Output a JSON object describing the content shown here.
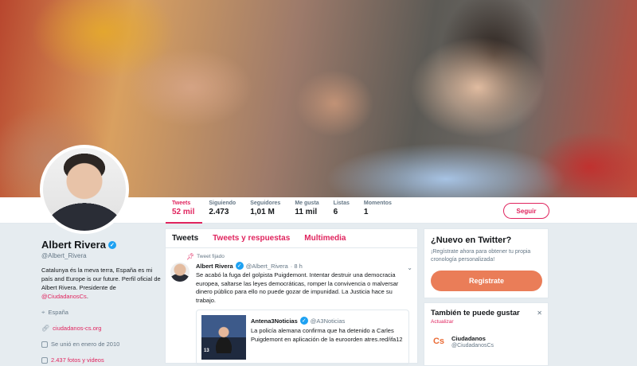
{
  "banner": {
    "alt": "header photo"
  },
  "stats": [
    {
      "label": "Tweets",
      "value": "52 mil"
    },
    {
      "label": "Siguiendo",
      "value": "2.473"
    },
    {
      "label": "Seguidores",
      "value": "1,01 M"
    },
    {
      "label": "Me gusta",
      "value": "11 mil"
    },
    {
      "label": "Listas",
      "value": "6"
    },
    {
      "label": "Momentos",
      "value": "1"
    }
  ],
  "follow_label": "Seguir",
  "profile": {
    "name": "Albert Rivera",
    "handle": "@Albert_Rivera",
    "bio": "Catalunya és la meva terra, España es mi país and Europe is our future. Perfil oficial de Albert Rivera. Presidente de",
    "bio_mention": "@CiudadanosCs",
    "bio_end": ".",
    "location": "España",
    "website": "ciudadanos-cs.org",
    "joined": "Se unió en enero de 2010",
    "media": "2.437 fotos y videos"
  },
  "tabs": [
    "Tweets",
    "Tweets y respuestas",
    "Multimedia"
  ],
  "tweet": {
    "pinned": "Tweet fijado",
    "name": "Albert Rivera",
    "handle": "@Albert_Rivera",
    "time": "· 8 h",
    "text": "Se acabó la fuga del golpista Puigdemont. Intentar destruir una democracia europea, saltarse las leyes democráticas, romper la convivencia o malversar dinero público para ello no puede gozar de impunidad. La Justicia hace su trabajo.",
    "quote": {
      "name": "Antena3Noticias",
      "handle": "@A3Noticias",
      "text": "La policía alemana confirma que ha detenido a Carles Puigdemont en aplicación de la euroorden atres.red/ifa12",
      "bug": "13"
    }
  },
  "signup_card": {
    "title": "¿Nuevo en Twitter?",
    "text": "¡Regístrate ahora para obtener tu propia cronología personalizada!",
    "button": "Registrate"
  },
  "suggest_card": {
    "title": "También te puede gustar",
    "update": "Actualizar",
    "name": "Ciudadanos",
    "handle": "@CiudadanosCs",
    "logo": "Cs"
  },
  "colors": {
    "accent": "#e0245e",
    "signup": "#ea7d58",
    "verified": "#1da1f2"
  }
}
